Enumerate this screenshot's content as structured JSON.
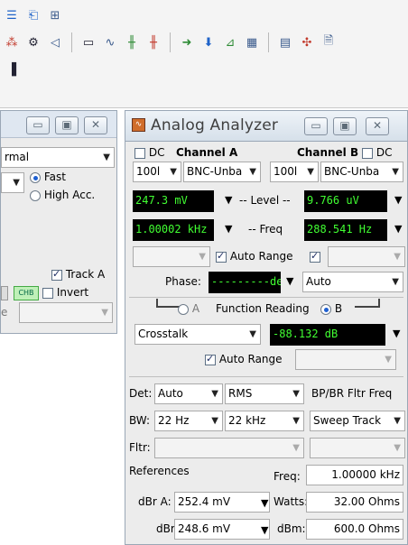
{
  "left_panel": {
    "combo_value": "rmal",
    "radio_fast": "Fast",
    "radio_high": "High Acc.",
    "track_label": "Track A",
    "chb_badge": "CHB",
    "invert_label": "Invert",
    "bottom_label": "e"
  },
  "window": {
    "title": "Analog Analyzer"
  },
  "channels": {
    "a_label": "Channel A",
    "b_label": "Channel B",
    "dc_label": "DC",
    "a_range": "100l",
    "a_input": "BNC-Unba",
    "b_range": "100l",
    "b_input": "BNC-Unba"
  },
  "level": {
    "label": "-- Level --",
    "a_value": "247.3  mV",
    "b_value": "9.766  uV"
  },
  "freq": {
    "label": "-- Freq",
    "a_value": "1.00002 kHz",
    "b_value": "288.541  Hz"
  },
  "auto_range_label": "Auto Range",
  "phase": {
    "label": "Phase:",
    "value": "---------deg",
    "mode": "Auto"
  },
  "function": {
    "radio_a": "A",
    "label": "Function Reading",
    "radio_b": "B",
    "type": "Crosstalk",
    "value": "-88.132  dB",
    "auto_range": "Auto Range"
  },
  "detector": {
    "det_label": "Det:",
    "det_value": "Auto",
    "rms": "RMS",
    "bp_label": "BP/BR Fltr Freq",
    "bw_label": "BW:",
    "bw_low": "22 Hz",
    "bw_high": "22 kHz",
    "sweep": "Sweep Track",
    "fltr_label": "Fltr:"
  },
  "references": {
    "title": "References",
    "freq_label": "Freq:",
    "freq_value": "1.00000 kHz",
    "dbra_label": "dBr A:",
    "dbra_value": "252.4  mV",
    "watts_label": "Watts:",
    "watts_value": "32.00   Ohms",
    "dbr_label": "dBr",
    "dbr_value": "248.6  mV",
    "dbm_label": "dBm:",
    "dbm_value": "600.0   Ohms"
  }
}
